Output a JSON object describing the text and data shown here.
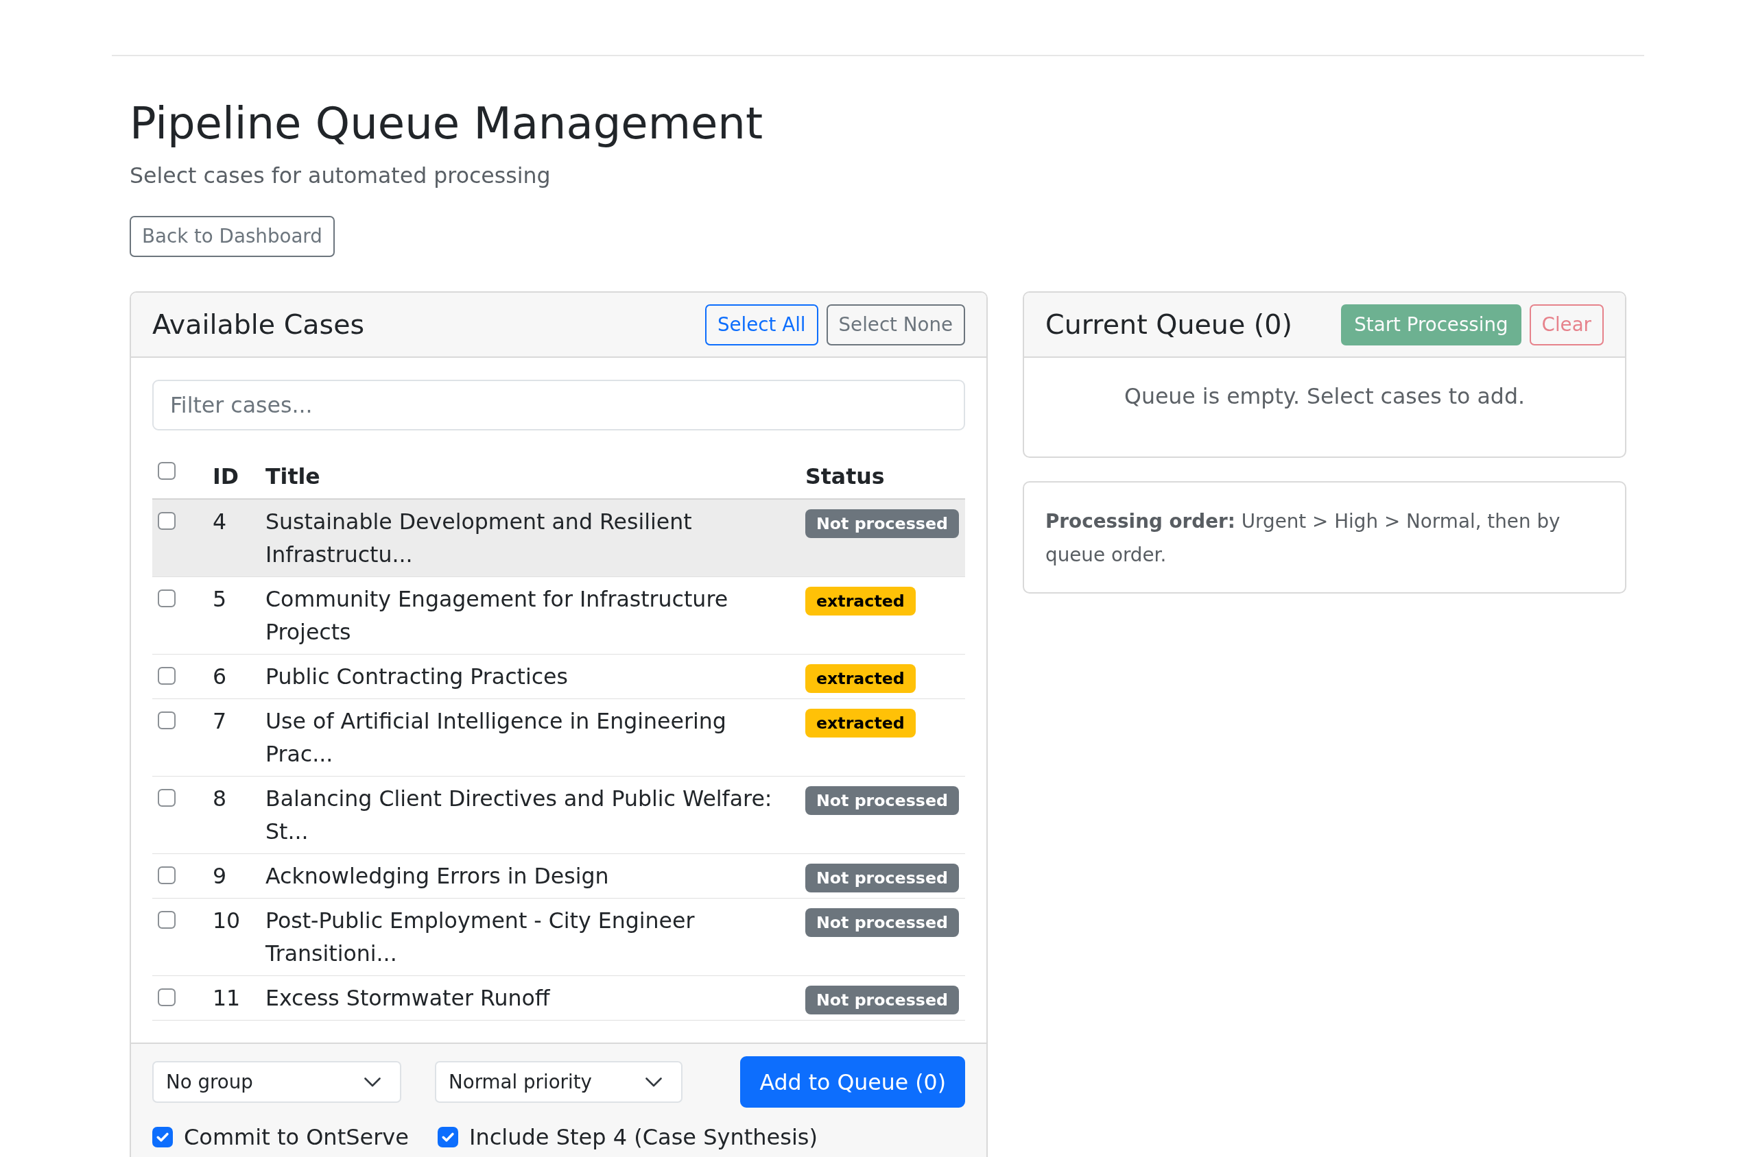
{
  "page_header": {
    "title": "Pipeline Queue Management",
    "subtitle": "Select cases for automated processing",
    "back_button": {
      "label": "Back to Dashboard"
    }
  },
  "available_cases": {
    "title": "Available Cases",
    "select_all_button": {
      "label": "Select All"
    },
    "select_none_button": {
      "label": "Select None"
    },
    "filter": {
      "placeholder": "Filter cases..."
    },
    "table": {
      "header_checkbox": {
        "checked": false
      },
      "columns": [
        "ID",
        "Title",
        "Status"
      ],
      "rows": [
        {
          "id": "4",
          "title": "Sustainable Development and Resilient Infrastructu...",
          "status": {
            "label": "Not processed",
            "kind": "not_processed"
          },
          "checked": false,
          "hovered": true
        },
        {
          "id": "5",
          "title": "Community Engagement for Infrastructure Projects",
          "status": {
            "label": "extracted",
            "kind": "extracted"
          },
          "checked": false,
          "hovered": false
        },
        {
          "id": "6",
          "title": "Public Contracting Practices",
          "status": {
            "label": "extracted",
            "kind": "extracted"
          },
          "checked": false,
          "hovered": false
        },
        {
          "id": "7",
          "title": "Use of Artificial Intelligence in Engineering Prac...",
          "status": {
            "label": "extracted",
            "kind": "extracted"
          },
          "checked": false,
          "hovered": false
        },
        {
          "id": "8",
          "title": "Balancing Client Directives and Public Welfare: St...",
          "status": {
            "label": "Not processed",
            "kind": "not_processed"
          },
          "checked": false,
          "hovered": false
        },
        {
          "id": "9",
          "title": "Acknowledging Errors in Design",
          "status": {
            "label": "Not processed",
            "kind": "not_processed"
          },
          "checked": false,
          "hovered": false
        },
        {
          "id": "10",
          "title": "Post-Public Employment - City Engineer Transitioni...",
          "status": {
            "label": "Not processed",
            "kind": "not_processed"
          },
          "checked": false,
          "hovered": false
        },
        {
          "id": "11",
          "title": "Excess Stormwater Runoff",
          "status": {
            "label": "Not processed",
            "kind": "not_processed"
          },
          "checked": false,
          "hovered": false
        }
      ]
    },
    "footer": {
      "group_select": {
        "value": "No group"
      },
      "priority_select": {
        "value": "Normal priority"
      },
      "add_button": {
        "label": "Add to Queue (0)"
      },
      "options": [
        {
          "label": "Commit to OntServe",
          "checked": true
        },
        {
          "label": "Include Step 4 (Case Synthesis)",
          "checked": true
        }
      ]
    }
  },
  "current_queue": {
    "title": "Current Queue (0)",
    "start_button": {
      "label": "Start Processing",
      "disabled": true
    },
    "clear_button": {
      "label": "Clear",
      "disabled": true
    },
    "empty_message": "Queue is empty. Select cases to add."
  },
  "processing_note": {
    "text": "**Processing order:** Urgent > High > Normal, then by queue order."
  }
}
